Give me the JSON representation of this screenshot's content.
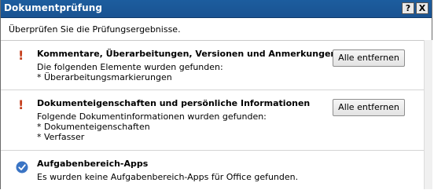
{
  "window": {
    "title": "Dokumentprüfung",
    "help_button": "?",
    "close_button": "X"
  },
  "instruction": "Überprüfen Sie die Prüfungsergebnisse.",
  "sections": [
    {
      "status": "warning",
      "title": "Kommentare, Überarbeitungen, Versionen und Anmerkungen",
      "lines": [
        "Die folgenden Elemente wurden gefunden:",
        "* Überarbeitungsmarkierungen"
      ],
      "button": "Alle entfernen"
    },
    {
      "status": "warning",
      "title": "Dokumenteigenschaften und persönliche Informationen",
      "lines": [
        "Folgende Dokumentinformationen wurden gefunden:",
        "* Dokumenteigenschaften",
        "* Verfasser"
      ],
      "button": "Alle entfernen"
    },
    {
      "status": "ok",
      "title": "Aufgabenbereich-Apps",
      "lines": [
        "Es wurden keine Aufgabenbereich-Apps für Office gefunden."
      ]
    }
  ],
  "colors": {
    "titlebar": "#1c5d9e",
    "warning": "#c53e1c",
    "ok": "#3a74c4"
  },
  "icons": {
    "warning": "exclamation-icon",
    "ok": "checkmark-circle-icon"
  }
}
